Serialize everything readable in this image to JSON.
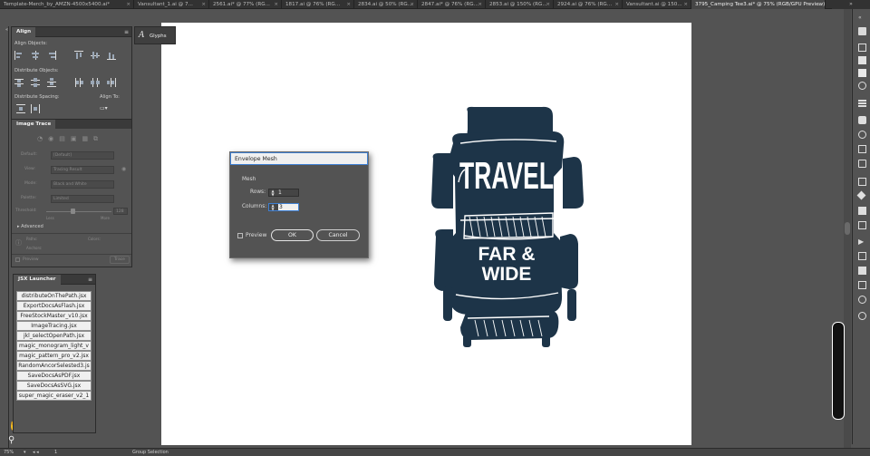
{
  "tabs": [
    {
      "label": "Template-Merch_by_AMZN-4500x5400.ai*",
      "active": false
    },
    {
      "label": "Vansultant_1.ai @ 7...",
      "active": false
    },
    {
      "label": "2561.ai* @ 77% (RG...",
      "active": false
    },
    {
      "label": "1817.ai @ 76% (RG...",
      "active": false
    },
    {
      "label": "2834.ai @ 50% (RG...",
      "active": false
    },
    {
      "label": "2847.ai* @ 76% (RG...",
      "active": false
    },
    {
      "label": "2853.ai @ 150% (RG...",
      "active": false
    },
    {
      "label": "2924.ai @ 76% (RG...",
      "active": false
    },
    {
      "label": "Vansultant.ai @ 150...",
      "active": false
    },
    {
      "label": "3795_Camping Tee3.ai* @ 75% (RGB/GPU Preview)",
      "active": true
    }
  ],
  "align_panel": {
    "tab": "Align",
    "align_objects": "Align Objects:",
    "distribute_objects": "Distribute Objects:",
    "distribute_spacing": "Distribute Spacing:",
    "align_to": "Align To:"
  },
  "image_trace": {
    "tab": "Image Trace",
    "preset_label": "Default:",
    "preset_value": "[Default]",
    "view_label": "View:",
    "view_value": "Tracing Result",
    "mode_label": "Mode:",
    "mode_value": "Black and White",
    "palette_label": "Palette:",
    "palette_value": "Limited",
    "threshold_label": "Threshold:",
    "threshold_value": "128",
    "less_label": "Less",
    "more_label": "More",
    "advanced_label": "Advanced",
    "paths_label": "Paths:",
    "anchors_label": "Anchors:",
    "colors_label": "Colors:",
    "preview_label": "Preview",
    "trace_button": "Trace"
  },
  "glyphs_panel": {
    "tab": "Glyphs"
  },
  "jsx_launcher": {
    "tab": "JSX Launcher",
    "items": [
      "distributeOnThePath.jsx",
      "ExportDocsAsFlash.jsx",
      "FreeStockMaster_v10.jsx",
      "ImageTracing.jsx",
      "jkl_selectOpenPath.jsx",
      "magic_monogram_light_v",
      "magic_pattern_pro_v2.jsx",
      "RandomAncorSelested3.js",
      "SaveDocsAsPDF.jsx",
      "SaveDocsAsSVG.jsx",
      "super_magic_eraser_v2_1"
    ]
  },
  "envelope_mesh": {
    "title": "Envelope Mesh",
    "mesh_label": "Mesh",
    "rows_label": "Rows:",
    "rows_value": "1",
    "columns_label": "Columns:",
    "columns_value": "3",
    "preview_label": "Preview",
    "ok_label": "OK",
    "cancel_label": "Cancel"
  },
  "artwork": {
    "line1": "TRAVEL",
    "line2": "FAR &",
    "line3": "WIDE",
    "color": "#1d3448"
  },
  "status": {
    "zoom": "75%",
    "page": "1",
    "tool": "Group Selection"
  },
  "colors": {
    "ui_bg": "#535353",
    "panel_dark": "#3a3a3a",
    "artboard": "#ffffff",
    "accent": "#3e7fd2"
  }
}
